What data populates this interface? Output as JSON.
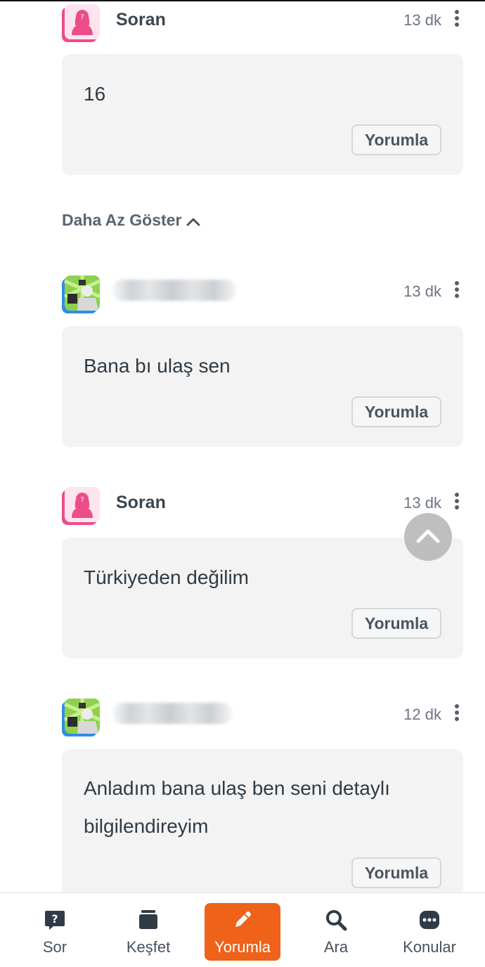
{
  "comments": [
    {
      "author": "Soran",
      "time": "13 dk",
      "text": "16",
      "reply": "Yorumla"
    },
    {
      "author": "",
      "time": "13 dk",
      "text": "Bana bı ulaş sen",
      "reply": "Yorumla"
    },
    {
      "author": "Soran",
      "time": "13 dk",
      "text": "Türkiyeden değilim",
      "reply": "Yorumla"
    },
    {
      "author": "",
      "time": "12 dk",
      "text": "Anladım bana ulaş ben seni detaylı bilgilendireyim",
      "reply": "Yorumla"
    }
  ],
  "show_less": "Daha Az Göster",
  "tabs": [
    {
      "label": "Sor",
      "icon": "question-bubble-icon"
    },
    {
      "label": "Keşfet",
      "icon": "cards-icon"
    },
    {
      "label": "Yorumla",
      "icon": "pencil-icon",
      "active": true
    },
    {
      "label": "Ara",
      "icon": "search-icon"
    },
    {
      "label": "Konular",
      "icon": "more-bubble-icon"
    }
  ],
  "colors": {
    "accent": "#ee6219",
    "female_avatar": "#ec4d8a",
    "male_avatar_ring": "#2f8de4",
    "bubble": "#f3f3f3"
  }
}
